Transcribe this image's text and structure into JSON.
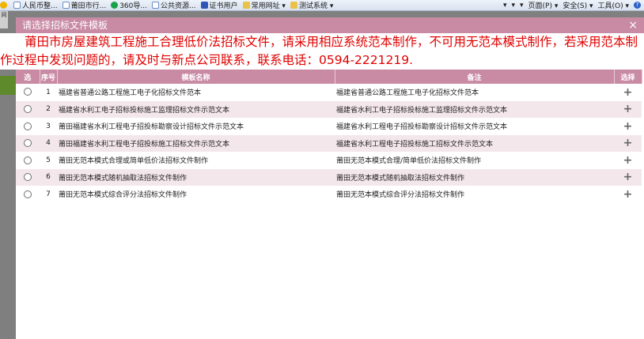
{
  "browser": {
    "favorites": [
      {
        "label": "人民币整...",
        "icon": "page-icon"
      },
      {
        "label": "莆田市行...",
        "icon": "page-icon"
      },
      {
        "label": "360导...",
        "icon": "360-icon"
      },
      {
        "label": "公共资源...",
        "icon": "page-icon"
      },
      {
        "label": "证书用户",
        "icon": "cert-icon"
      },
      {
        "label": "常用网址 ▾",
        "icon": "folder-icon"
      },
      {
        "label": "测试系统 ▾",
        "icon": "folder-icon"
      }
    ],
    "tools": [
      "▾",
      "▾",
      "▾",
      "页面(P) ▾",
      "安全(S) ▾",
      "工具(O) ▾"
    ],
    "help_icon": "?"
  },
  "left_strip": {
    "tab_label": "网"
  },
  "dialog": {
    "title": "请选择招标文件模板",
    "close": "×",
    "notice": "莆田市房屋建筑工程施工合理低价法招标文件，请采用相应系统范本制作，不可用无范本模式制作，若采用范本制作过程中发现问题的，请及时与新点公司联系，联系电话：0594-2221219.",
    "notice_color": "#e00000",
    "header_color": "#c98aa3"
  },
  "table": {
    "headers": {
      "radio": "选",
      "no": "序号",
      "name": "模板名称",
      "note": "备注",
      "select": "选择"
    },
    "rows": [
      {
        "no": "1",
        "name": "福建省普通公路工程施工电子化招标文件范本",
        "note": "福建省普通公路工程施工电子化招标文件范本",
        "select": "+"
      },
      {
        "no": "2",
        "name": "福建省水利工电子招标投标施工监理招标文件示范文本",
        "note": "福建省水利工电子招标投标施工监理招标文件示范文本",
        "select": "+"
      },
      {
        "no": "3",
        "name": "莆田福建省水利工程电子招投标勘察设计招标文件示范文本",
        "note": "福建省水利工程电子招投标勘察设计招标文件示范文本",
        "select": "+"
      },
      {
        "no": "4",
        "name": "莆田福建省水利工程电子招投标施工招标文件示范文本",
        "note": "福建省水利工程电子招投标施工招标文件示范文本",
        "select": "+"
      },
      {
        "no": "5",
        "name": "莆田无范本模式合理或简单低价法招标文件制作",
        "note": "莆田无范本模式合理/简单低价法招标文件制作",
        "select": "+"
      },
      {
        "no": "6",
        "name": "莆田无范本模式随机抽取法招标文件制作",
        "note": "莆田无范本模式随机抽取法招标文件制作",
        "select": "+"
      },
      {
        "no": "7",
        "name": "莆田无范本模式综合评分法招标文件制作",
        "note": "莆田无范本模式综合评分法招标文件制作",
        "select": "+"
      }
    ]
  }
}
